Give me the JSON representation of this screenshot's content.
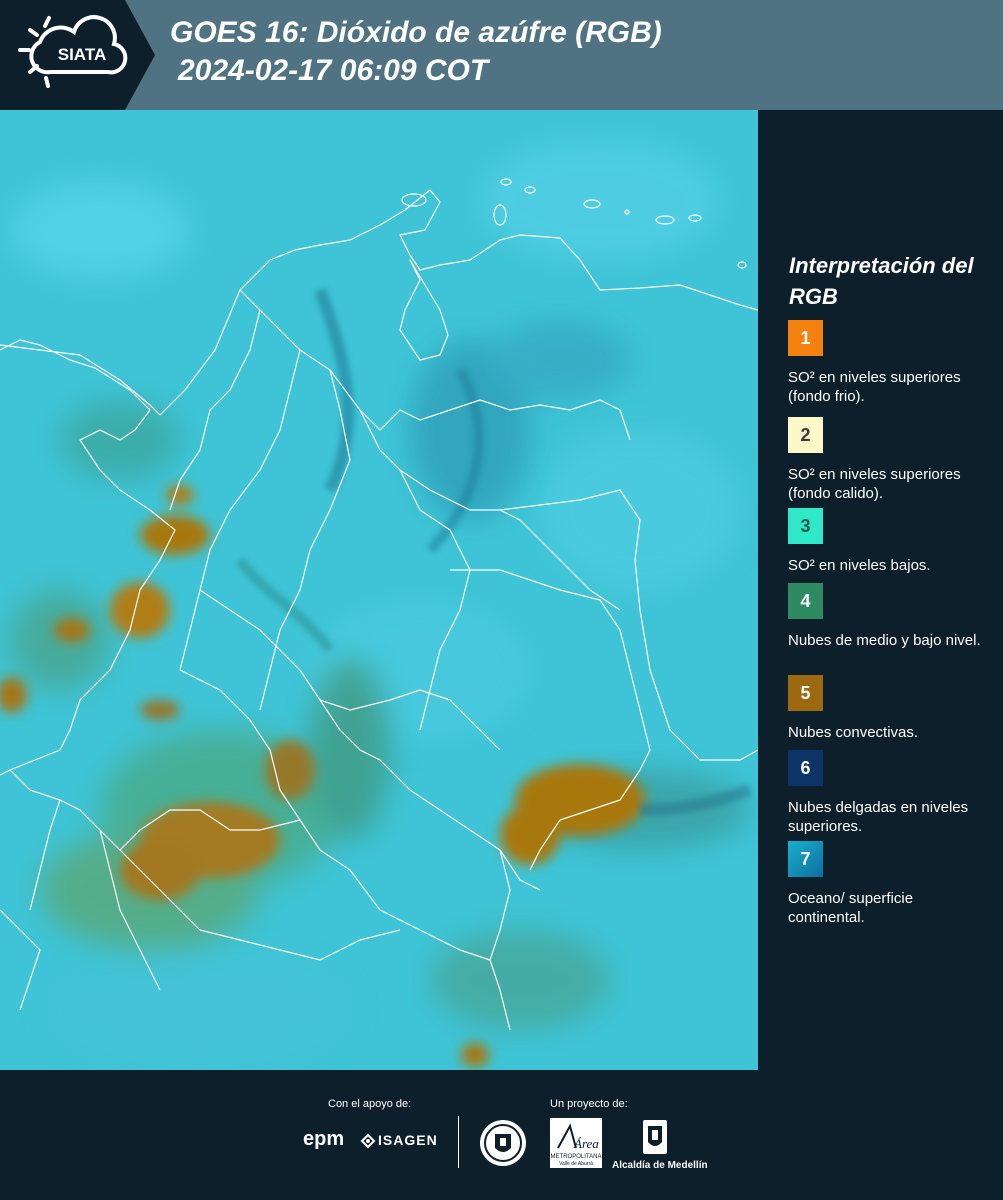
{
  "header": {
    "logo_text": "SIATA",
    "title_line1": "GOES 16: Dióxido de azúfre (RGB)",
    "title_line2": "2024-02-17 06:09 COT",
    "background": "#4f7382",
    "logo_background": "#0d1f2b"
  },
  "legend": {
    "title": "Interpretación del RGB",
    "items": [
      {
        "number": "1",
        "text": "SO² en niveles superiores (fondo frio).",
        "color": "#f5820f",
        "number_color": "#ffffff"
      },
      {
        "number": "2",
        "text": "SO² en niveles superiores (fondo calido).",
        "color": "#fcf8c8",
        "number_color": "#3a3a3a"
      },
      {
        "number": "3",
        "text": "SO² en niveles bajos.",
        "color": "#2ee8c8",
        "number_color": "#1a5a50"
      },
      {
        "number": "4",
        "text": "Nubes de medio y bajo nivel.",
        "color": "#2e8a60",
        "number_color": "#ffffff"
      },
      {
        "number": "5",
        "text": "Nubes convectivas.",
        "color": "#9c6810",
        "number_color": "#ffffff"
      },
      {
        "number": "6",
        "text": "Nubes delgadas en niveles superiores.",
        "color": "#0c3468",
        "number_color": "#ffffff"
      },
      {
        "number": "7",
        "text": "Oceano/ superficie continental.",
        "color": "#1a92c0",
        "number_color": "#ffffff"
      }
    ]
  },
  "footer": {
    "support_label": "Con el apoyo de:",
    "project_label": "Un proyecto de:",
    "sponsor_epm": "epm",
    "sponsor_isagen": "ISAGEN",
    "partner_amva_1": "Área",
    "partner_amva_2": "METROPOLITANA",
    "partner_amva_3": "Valle de Aburrá",
    "partner_alcaldia": "Alcaldía de Medellín"
  },
  "colors": {
    "map_background": "#3ec4d6",
    "convective": "#a8780e",
    "page_background": "#0d1f2b"
  }
}
